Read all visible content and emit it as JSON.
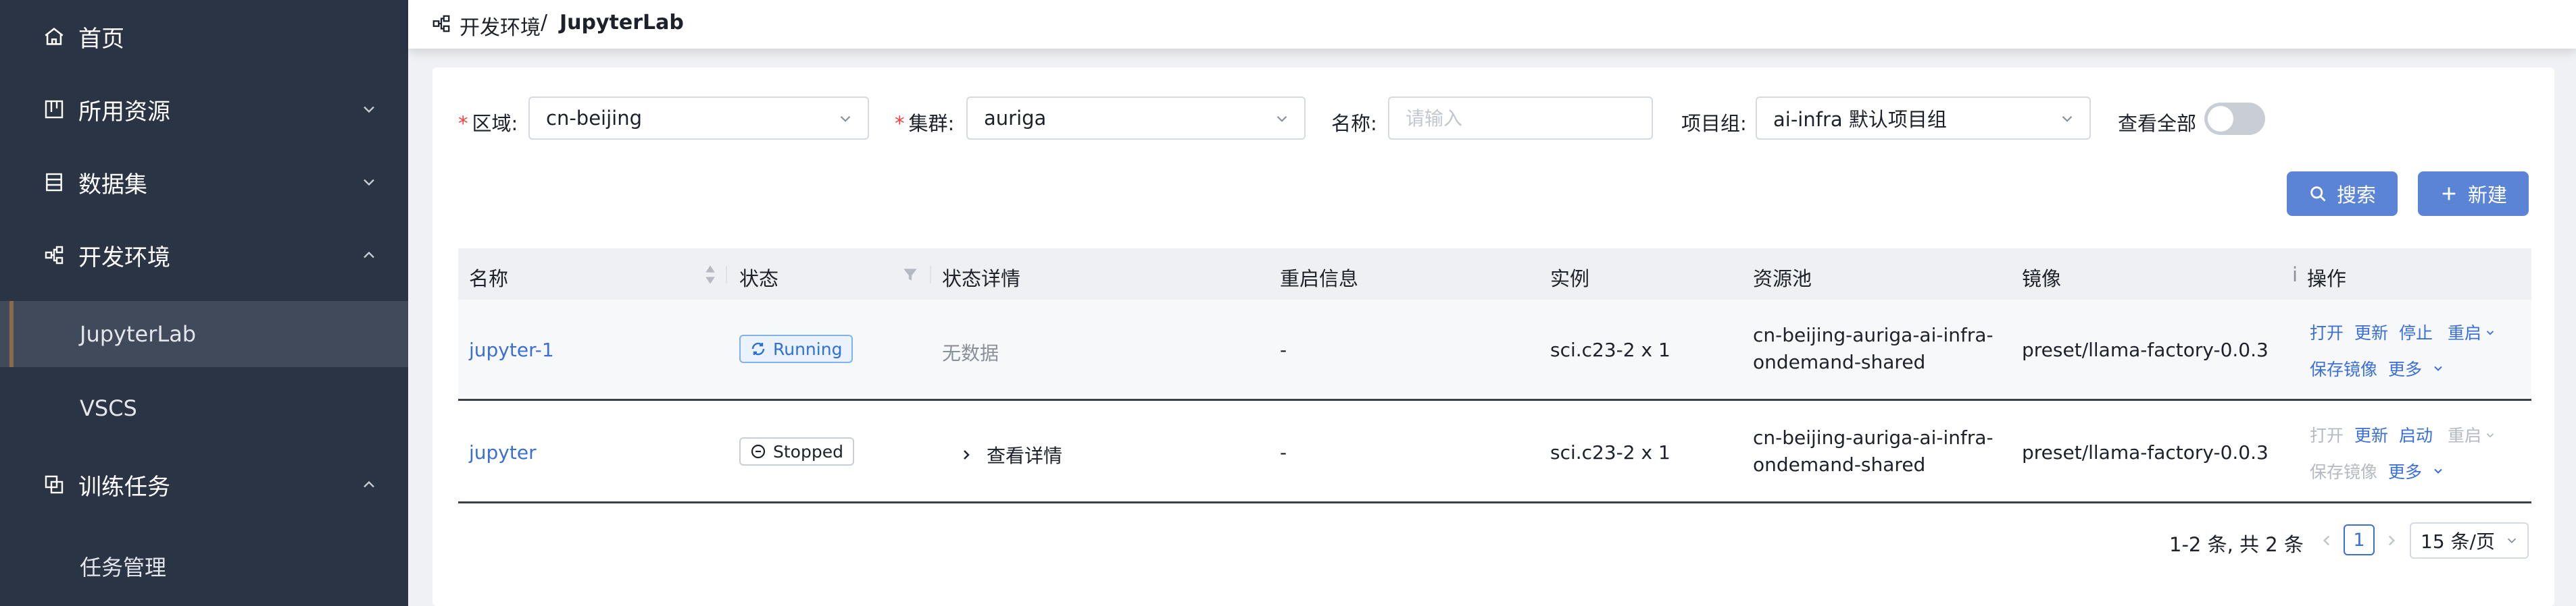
{
  "sidebar": {
    "items": [
      {
        "label": "首页"
      },
      {
        "label": "所用资源"
      },
      {
        "label": "数据集"
      },
      {
        "label": "开发环境"
      },
      {
        "label": "训练任务"
      }
    ],
    "dev_sub": [
      "JupyterLab",
      "VSCS"
    ],
    "train_sub": [
      "任务管理"
    ]
  },
  "breadcrumb": {
    "parent": "开发环境",
    "separator": "/",
    "current": "JupyterLab"
  },
  "filters": {
    "region_label": "区域:",
    "region_value": "cn-beijing",
    "cluster_label": "集群:",
    "cluster_value": "auriga",
    "name_label": "名称:",
    "name_placeholder": "请输入",
    "project_label": "项目组:",
    "project_value": "ai-infra 默认项目组",
    "view_all_label": "查看全部",
    "view_all_on": false
  },
  "actions": {
    "search": "搜索",
    "create": "新建"
  },
  "table": {
    "headers": {
      "name": "名称",
      "status": "状态",
      "status_detail": "状态详情",
      "restart": "重启信息",
      "instance": "实例",
      "pool": "资源池",
      "image": "镜像",
      "ops": "操作",
      "hint": "i"
    },
    "rows": [
      {
        "name": "jupyter-1",
        "status": "Running",
        "detail": "无数据",
        "restart": "-",
        "instance": "sci.c23-2 x 1",
        "pool_line1": "cn-beijing-auriga-ai-infra-",
        "pool_line2": "ondemand-shared",
        "image": "preset/llama-factory-0.0.3",
        "ops": {
          "open": "打开",
          "update": "更新",
          "third": "停止",
          "restart": "重启",
          "save": "保存镜像",
          "more": "更多"
        }
      },
      {
        "name": "jupyter",
        "status": "Stopped",
        "detail": "查看详情",
        "restart": "-",
        "instance": "sci.c23-2 x 1",
        "pool_line1": "cn-beijing-auriga-ai-infra-",
        "pool_line2": "ondemand-shared",
        "image": "preset/llama-factory-0.0.3",
        "ops": {
          "open": "打开",
          "update": "更新",
          "third": "启动",
          "restart": "重启",
          "save": "保存镜像",
          "more": "更多"
        }
      }
    ]
  },
  "pagination": {
    "summary": "1-2 条, 共 2 条",
    "current": "1",
    "page_size": "15 条/页"
  },
  "colors": {
    "sidebar": "#2b3445",
    "primary": "#5b84d6",
    "link": "#3a6fd8",
    "required": "#f53f3f"
  }
}
